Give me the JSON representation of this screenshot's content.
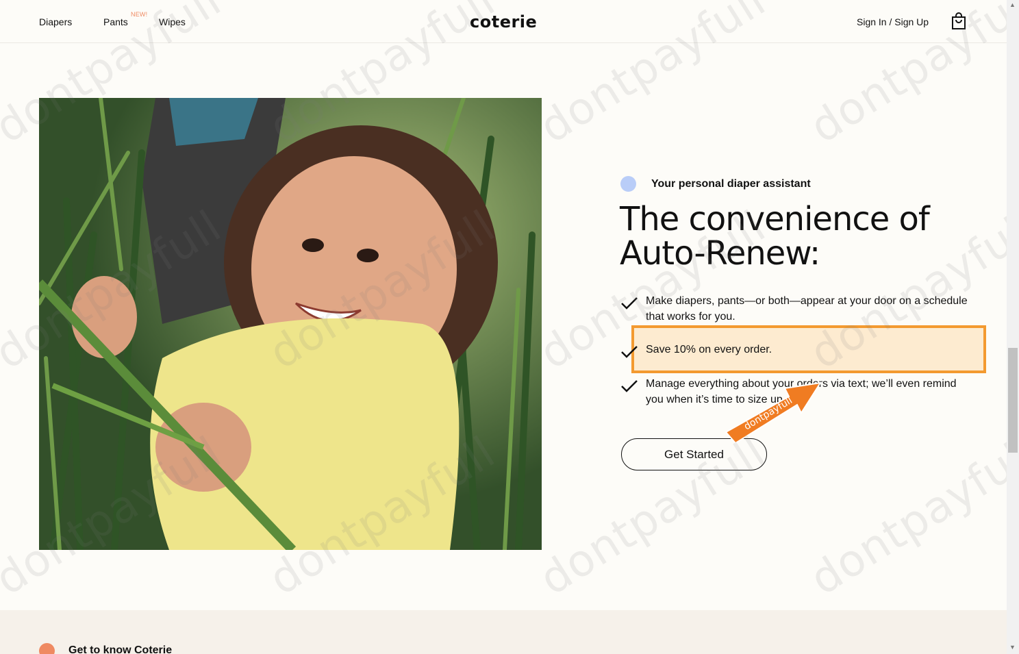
{
  "header": {
    "nav": [
      {
        "label": "Diapers"
      },
      {
        "label": "Pants",
        "badge": "NEW!"
      },
      {
        "label": "Wipes"
      }
    ],
    "logo": "coterie",
    "signin_label": "Sign In / Sign Up",
    "cart_icon": "shopping-bag-icon"
  },
  "hero": {
    "eyebrow": "Your personal diaper assistant",
    "headline": "The convenience of Auto-Renew:",
    "benefits": [
      {
        "text": "Make diapers, pants—or both—appear at your door on a schedule that works for you."
      },
      {
        "text": "Save 10% on every order."
      },
      {
        "text": "Manage everything about your orders via text; we’ll even remind you when it’s time to size up."
      }
    ],
    "cta_label": "Get Started",
    "check_icon": "checkmark-icon",
    "accent_dot_color": "#b9cdf8"
  },
  "annotation": {
    "highlight_color": "#f39a30",
    "arrow_label": "dontpayfull",
    "arrow_color": "#f07c22"
  },
  "next_section": {
    "title": "Get to know Coterie",
    "dot_color": "#ef8a62"
  },
  "watermark": "dontpayfull",
  "colors": {
    "background": "#fdfcf8",
    "text": "#111111",
    "section_bg": "#f6f1ea"
  }
}
